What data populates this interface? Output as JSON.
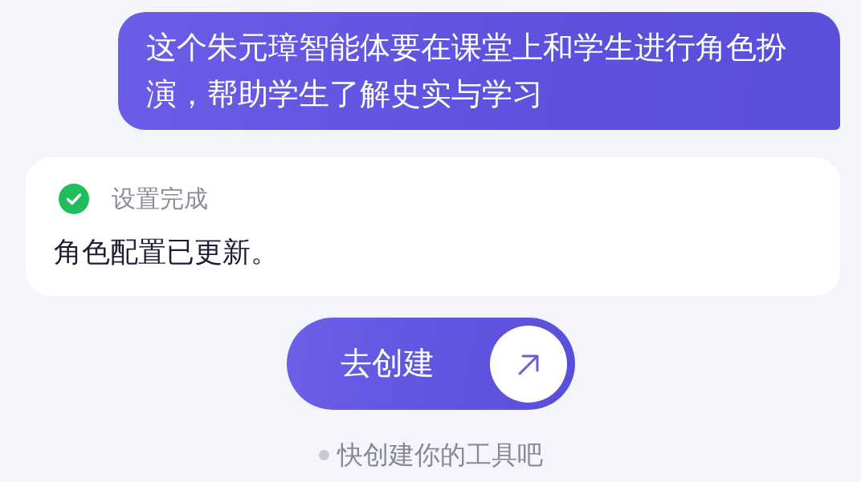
{
  "user_message": {
    "text": "这个朱元璋智能体要在课堂上和学生进行角色扮演，帮助学生了解史实与学习"
  },
  "status_card": {
    "status": {
      "kind": "success",
      "label": "设置完成"
    },
    "message": "角色配置已更新。"
  },
  "action_button": {
    "label": "去创建"
  },
  "hint": {
    "text": "快创建你的工具吧"
  }
}
